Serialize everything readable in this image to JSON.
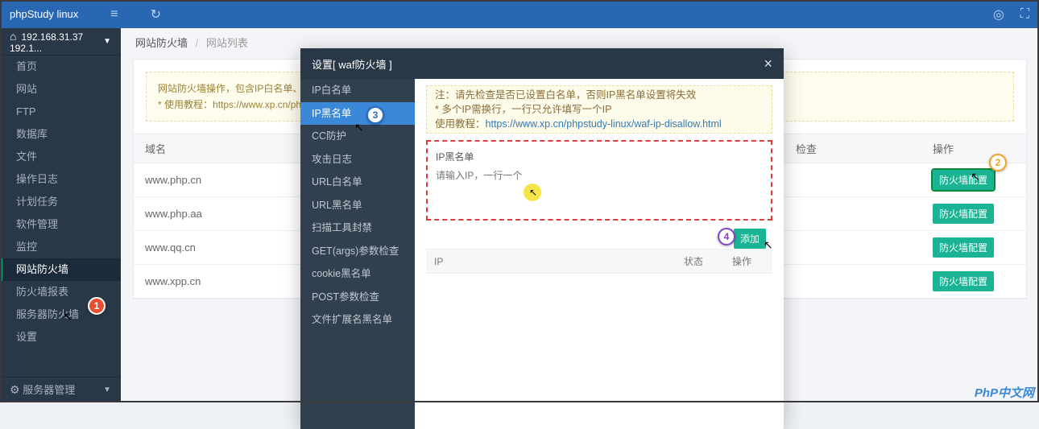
{
  "topbar": {
    "brand": "phpStudy linux"
  },
  "ip_bar": {
    "address": "192.168.31.37 192.1..."
  },
  "sidebar": {
    "items": [
      {
        "label": "首页"
      },
      {
        "label": "网站"
      },
      {
        "label": "FTP"
      },
      {
        "label": "数据库"
      },
      {
        "label": "文件"
      },
      {
        "label": "操作日志"
      },
      {
        "label": "计划任务"
      },
      {
        "label": "软件管理"
      },
      {
        "label": "监控"
      },
      {
        "label": "网站防火墙"
      },
      {
        "label": "防火墙报表"
      },
      {
        "label": "服务器防火墙"
      },
      {
        "label": "设置"
      }
    ],
    "footer": "服务器管理"
  },
  "breadcrumb": {
    "root": "网站防火墙",
    "current": "网站列表"
  },
  "notice": {
    "line1": "网站防火墙操作，包含IP白名单、黑名单,",
    "line2_prefix": "* 使用教程：",
    "line2_url": "https://www.xp.cn/phpstudy-lin"
  },
  "table": {
    "cols": {
      "domain": "域名",
      "check": "检查",
      "actions": "操作"
    },
    "rows": [
      {
        "domain": "www.php.cn",
        "btn": "防火墙配置"
      },
      {
        "domain": "www.php.aa",
        "btn": "防火墙配置"
      },
      {
        "domain": "www.qq.cn",
        "btn": "防火墙配置"
      },
      {
        "domain": "www.xpp.cn",
        "btn": "防火墙配置"
      }
    ]
  },
  "modal": {
    "title": "设置[ waf防火墙 ]",
    "side": [
      {
        "label": "IP白名单"
      },
      {
        "label": "IP黑名单"
      },
      {
        "label": "CC防护"
      },
      {
        "label": "攻击日志"
      },
      {
        "label": "URL白名单"
      },
      {
        "label": "URL黑名单"
      },
      {
        "label": "扫描工具封禁"
      },
      {
        "label": "GET(args)参数检查"
      },
      {
        "label": "cookie黑名单"
      },
      {
        "label": "POST参数检查"
      },
      {
        "label": "文件扩展名黑名单"
      }
    ],
    "warn": {
      "l1": "注：请先检查是否已设置白名单，否则IP黑名单设置将失效",
      "l2": "* 多个IP需换行，一行只允许填写一个IP",
      "l3_prefix": "使用教程：",
      "l3_url": "https://www.xp.cn/phpstudy-linux/waf-ip-disallow.html"
    },
    "blacklist": {
      "title": "IP黑名单",
      "placeholder": "请输入IP，一行一个"
    },
    "add_btn": "添加",
    "sub_cols": {
      "ip": "IP",
      "status": "状态",
      "actions": "操作"
    }
  },
  "badges": {
    "b1": "1",
    "b2": "2",
    "b3": "3",
    "b4": "4"
  },
  "watermark": "PhP中文网"
}
